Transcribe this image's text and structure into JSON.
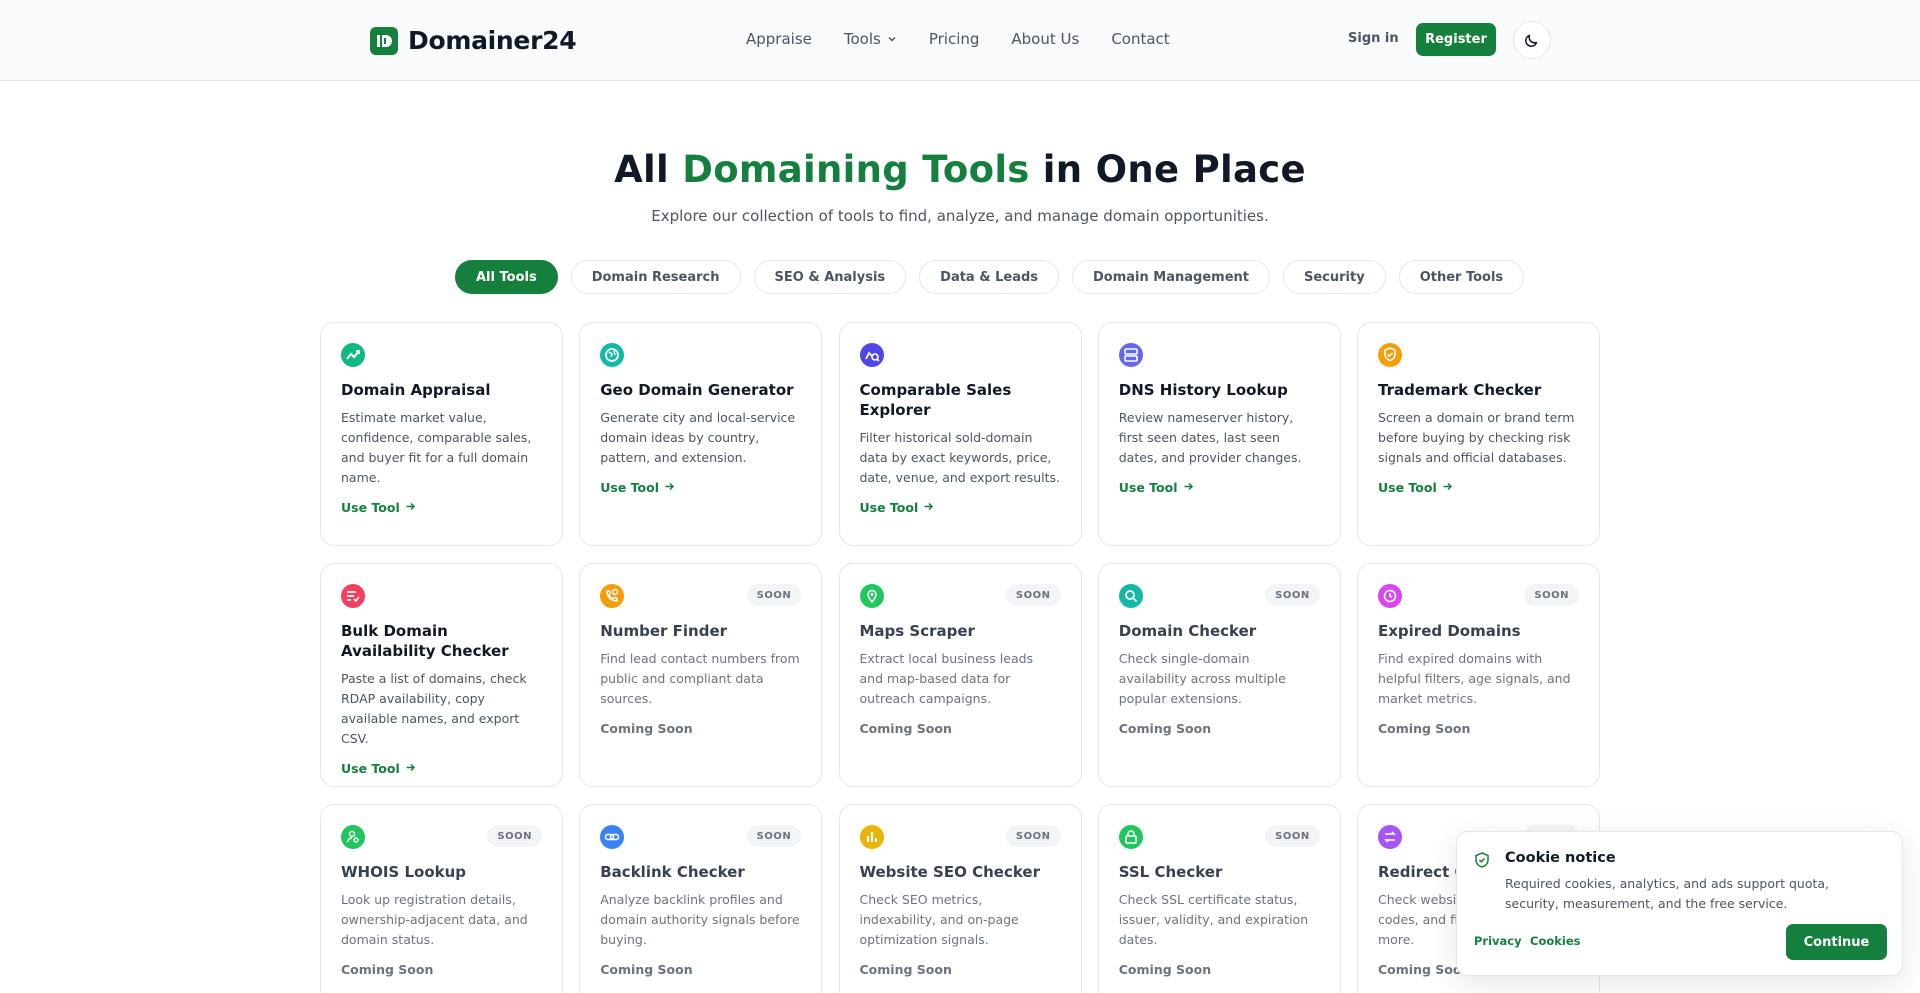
{
  "brand": {
    "name": "Domainer24",
    "accent": "#15803d"
  },
  "nav": {
    "items": [
      {
        "label": "Appraise",
        "name": "nav-appraise"
      },
      {
        "label": "Tools",
        "name": "nav-tools",
        "dropdown": true
      },
      {
        "label": "Pricing",
        "name": "nav-pricing"
      },
      {
        "label": "About Us",
        "name": "nav-about-us"
      },
      {
        "label": "Contact",
        "name": "nav-contact"
      }
    ],
    "signin_label": "Sign in",
    "register_label": "Register",
    "theme_icon": "moon-icon"
  },
  "hero": {
    "title_pre": "All ",
    "title_accent": "Domaining Tools",
    "title_post": " in One Place",
    "subtitle": "Explore our collection of tools to find, analyze, and manage domain opportunities."
  },
  "filters": [
    {
      "label": "All Tools",
      "active": true
    },
    {
      "label": "Domain Research",
      "active": false
    },
    {
      "label": "SEO & Analysis",
      "active": false
    },
    {
      "label": "Data & Leads",
      "active": false
    },
    {
      "label": "Domain Management",
      "active": false
    },
    {
      "label": "Security",
      "active": false
    },
    {
      "label": "Other Tools",
      "active": false
    }
  ],
  "labels": {
    "use_tool": "Use Tool",
    "coming_soon": "Coming Soon",
    "soon_badge": "SOON"
  },
  "tools": [
    {
      "title": "Domain Appraisal",
      "desc": "Estimate market value, confidence, comparable sales, and buyer fit for a full domain name.",
      "status": "live",
      "icon": "trending-up-icon",
      "color": "#10b981"
    },
    {
      "title": "Geo Domain Generator",
      "desc": "Generate city and local-service domain ideas by country, pattern, and extension.",
      "status": "live",
      "icon": "globe-icon",
      "color": "#14b8a6"
    },
    {
      "title": "Comparable Sales Explorer",
      "desc": "Filter historical sold-domain data by exact keywords, price, date, venue, and export results.",
      "status": "live",
      "icon": "chart-search-icon",
      "color": "#4f46e5"
    },
    {
      "title": "DNS History Lookup",
      "desc": "Review nameserver history, first seen dates, last seen dates, and provider changes.",
      "status": "live",
      "icon": "server-icon",
      "color": "#6366f1"
    },
    {
      "title": "Trademark Checker",
      "desc": "Screen a domain or brand term before buying by checking risk signals and official databases.",
      "status": "live",
      "icon": "shield-check-icon",
      "color": "#f59e0b"
    },
    {
      "title": "Bulk Domain Availability Checker",
      "desc": "Paste a list of domains, check RDAP availability, copy available names, and export CSV.",
      "status": "live",
      "icon": "list-check-icon",
      "color": "#f43f5e"
    },
    {
      "title": "Number Finder",
      "desc": "Find lead contact numbers from public and compliant data sources.",
      "status": "soon",
      "icon": "phone-search-icon",
      "color": "#f59e0b"
    },
    {
      "title": "Maps Scraper",
      "desc": "Extract local business leads and map-based data for outreach campaigns.",
      "status": "soon",
      "icon": "map-pin-icon",
      "color": "#22c55e"
    },
    {
      "title": "Domain Checker",
      "desc": "Check single-domain availability across multiple popular extensions.",
      "status": "soon",
      "icon": "search-icon",
      "color": "#14b8a6"
    },
    {
      "title": "Expired Domains",
      "desc": "Find expired domains with helpful filters, age signals, and market metrics.",
      "status": "soon",
      "icon": "clock-icon",
      "color": "#d946ef"
    },
    {
      "title": "WHOIS Lookup",
      "desc": "Look up registration details, ownership-adjacent data, and domain status.",
      "status": "soon",
      "icon": "user-search-icon",
      "color": "#22c55e"
    },
    {
      "title": "Backlink Checker",
      "desc": "Analyze backlink profiles and domain authority signals before buying.",
      "status": "soon",
      "icon": "link-icon",
      "color": "#3b82f6"
    },
    {
      "title": "Website SEO Checker",
      "desc": "Check SEO metrics, indexability, and on-page optimization signals.",
      "status": "soon",
      "icon": "bar-chart-icon",
      "color": "#eab308"
    },
    {
      "title": "SSL Checker",
      "desc": "Check SSL certificate status, issuer, validity, and expiration dates.",
      "status": "soon",
      "icon": "lock-icon",
      "color": "#22c55e"
    },
    {
      "title": "Redirect Checker",
      "desc": "Check website redirects, status codes, and final URLs, and more.",
      "status": "soon",
      "icon": "redirect-icon",
      "color": "#a855f7"
    }
  ],
  "cookie": {
    "title": "Cookie notice",
    "text": "Required cookies, analytics, and ads support quota, security, measurement, and the free service.",
    "privacy_label": "Privacy",
    "cookies_label": "Cookies",
    "continue_label": "Continue"
  }
}
